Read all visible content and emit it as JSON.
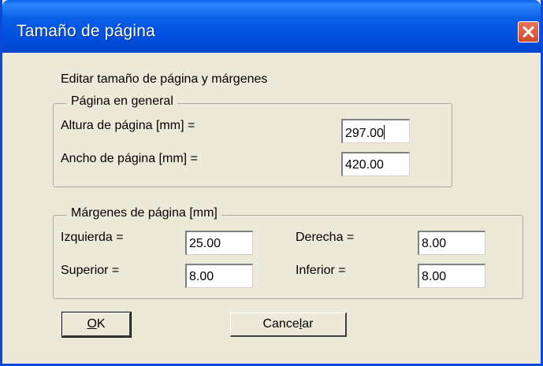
{
  "window": {
    "title": "Tamaño de página",
    "title_bar_color": "#0050df",
    "close_icon": "close-icon"
  },
  "dialog": {
    "heading": "Editar tamaño de página y márgenes",
    "page_group": {
      "title": "Página en general",
      "height_label": "Altura de página [mm] =",
      "height_value": "297.00",
      "width_label": "Ancho de página [mm] =",
      "width_value": "420.00"
    },
    "margins_group": {
      "title": "Márgenes de página [mm]",
      "left_label": "Izquierda =",
      "left_value": "25.00",
      "right_label": "Derecha =",
      "right_value": "8.00",
      "top_label": "Superior =",
      "top_value": "8.00",
      "bottom_label": "Inferior =",
      "bottom_value": "8.00"
    },
    "buttons": {
      "ok_mnemonic": "O",
      "ok_rest": "K",
      "cancel_prefix": "Cance",
      "cancel_mnemonic": "l",
      "cancel_suffix": "ar"
    }
  }
}
